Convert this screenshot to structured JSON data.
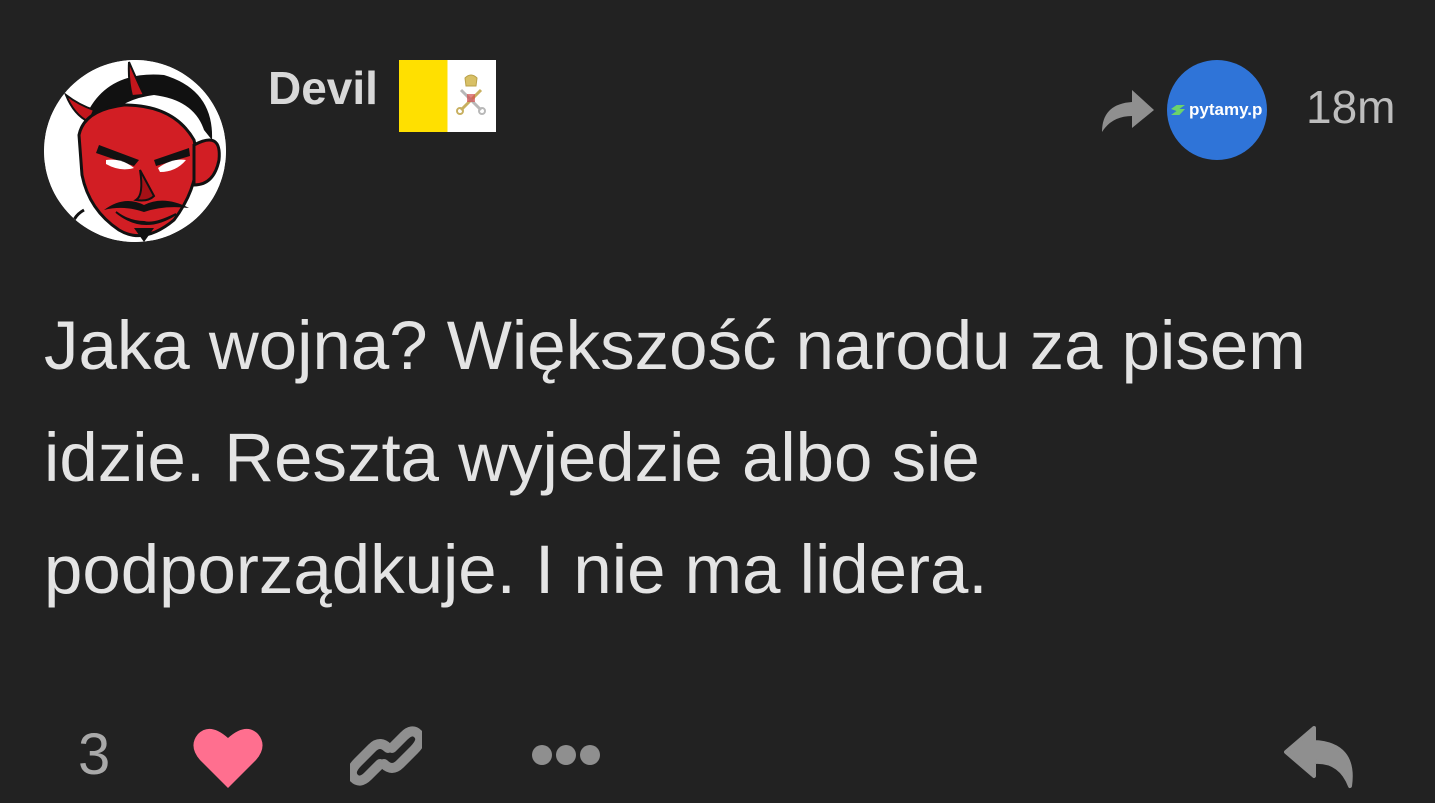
{
  "post": {
    "author": {
      "name": "Devil",
      "avatar_icon": "devil-face-icon",
      "flag_icon": "vatican-flag-icon"
    },
    "share_icon": "share-arrow-icon",
    "source": {
      "label": "pytamy.p"
    },
    "timestamp": "18m",
    "text": "Jaka wojna? Większość narodu za pisem idzie. Reszta wyjedzie albo sie podporządkuje. I nie ma lidera.",
    "actions": {
      "like_count": "3",
      "like_icon": "heart-icon",
      "link_icon": "link-icon",
      "more_icon": "more-dots-icon",
      "reply_icon": "reply-icon"
    }
  },
  "colors": {
    "background": "#222222",
    "heart": "#ff6f8f",
    "icon_gray": "#8f8f8f",
    "source_blue": "#2f74d8",
    "flag_yellow": "#ffe000"
  }
}
